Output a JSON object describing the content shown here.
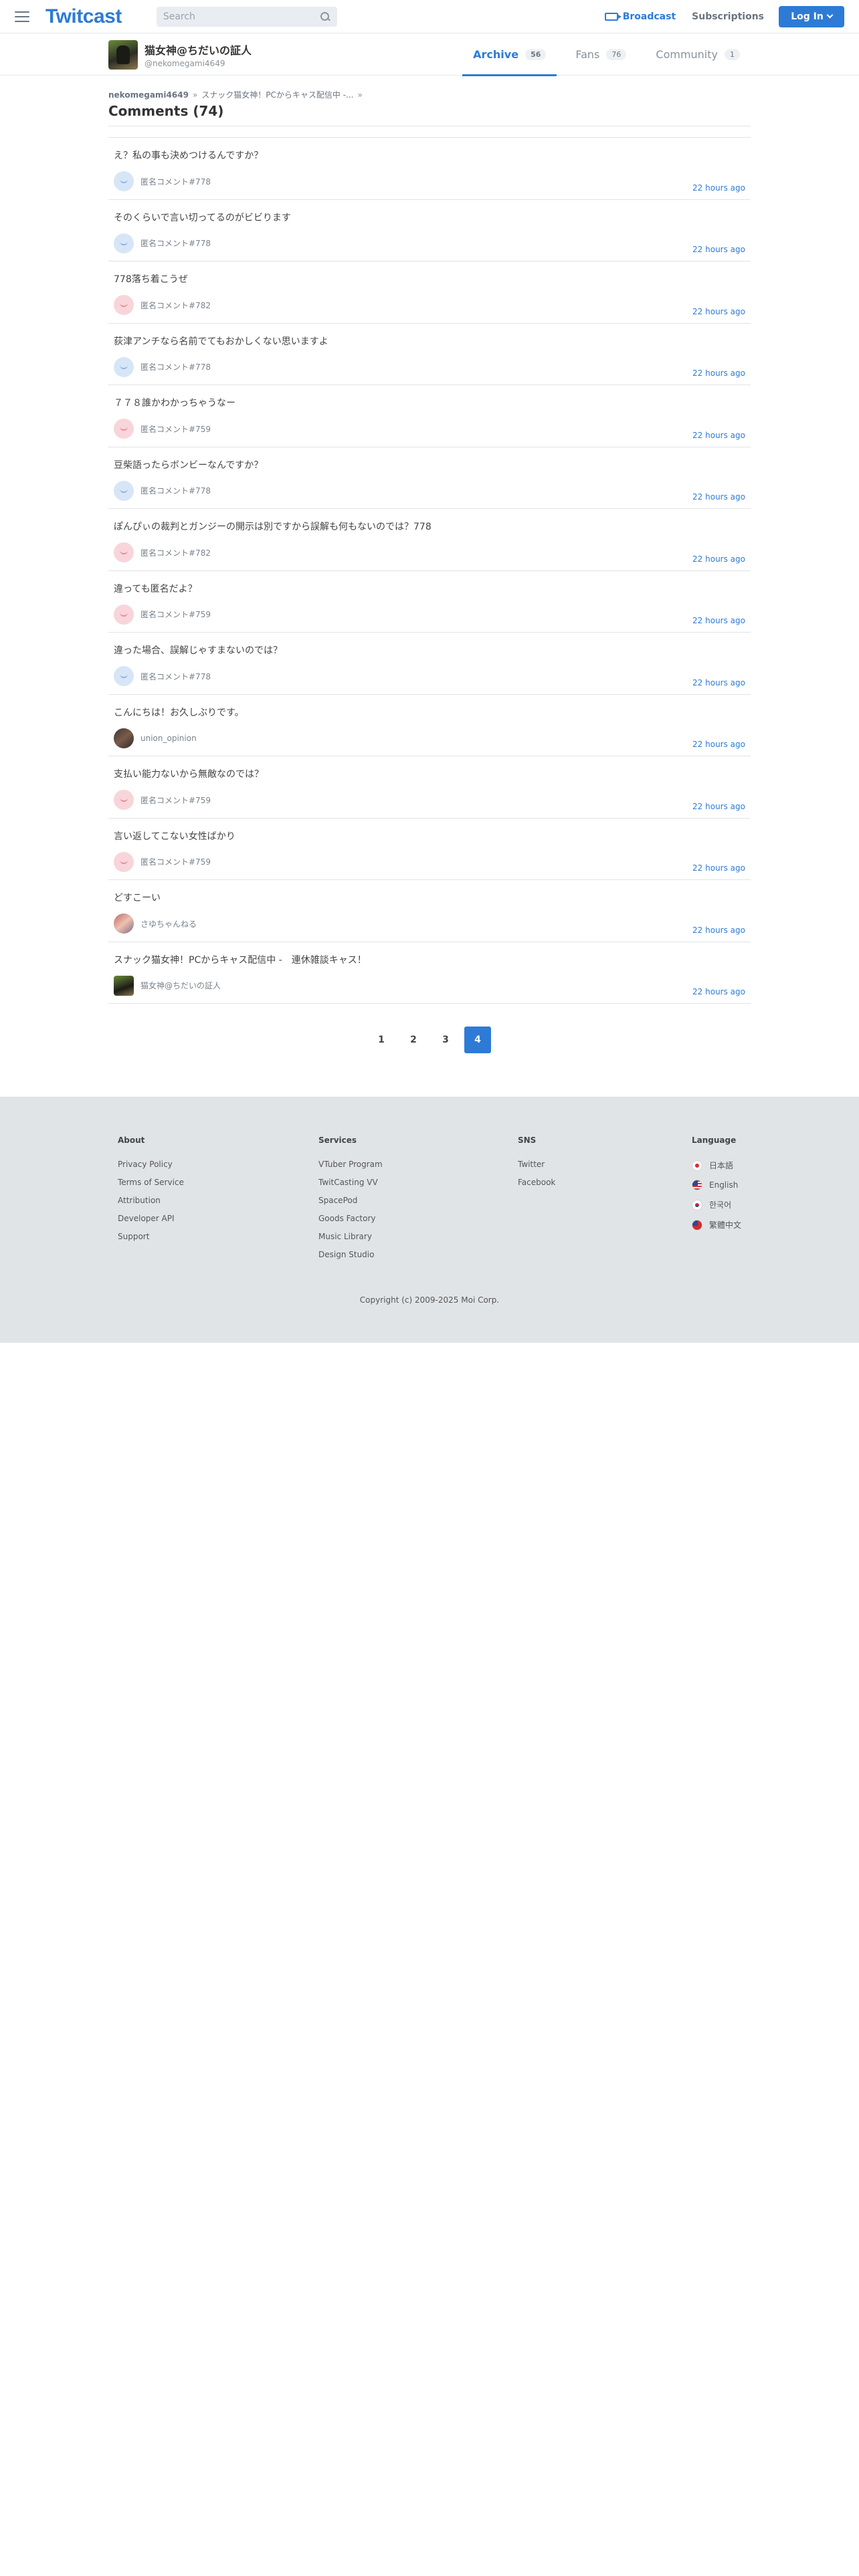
{
  "header": {
    "logo": "Twitcast",
    "search_placeholder": "Search",
    "broadcast_label": "Broadcast",
    "subscriptions_label": "Subscriptions",
    "login_label": "Log In"
  },
  "profile": {
    "name": "猫女神@ちだいの証人",
    "handle": "@nekomegami4649",
    "tabs": [
      {
        "label": "Archive",
        "count": "56"
      },
      {
        "label": "Fans",
        "count": "76"
      },
      {
        "label": "Community",
        "count": "1"
      }
    ]
  },
  "breadcrumb": {
    "user": "nekomegami4649",
    "sep1": "»",
    "movie": "スナック猫女神！PCからキャス配信中 -...",
    "sep2": "»"
  },
  "page_title": "Comments (74)",
  "comments": [
    {
      "message": "え？私の事も決めつけるんですか？",
      "user": "匿名コメント#778",
      "avatar": "blue",
      "time": "22 hours ago"
    },
    {
      "message": "そのくらいで言い切ってるのがビビります",
      "user": "匿名コメント#778",
      "avatar": "blue",
      "time": "22 hours ago"
    },
    {
      "message": "778落ち着こうぜ",
      "user": "匿名コメント#782",
      "avatar": "pink",
      "time": "22 hours ago"
    },
    {
      "message": "荻津アンチなら名前でてもおかしくない思いますよ",
      "user": "匿名コメント#778",
      "avatar": "blue",
      "time": "22 hours ago"
    },
    {
      "message": "７７８誰かわかっちゃうなー",
      "user": "匿名コメント#759",
      "avatar": "pink",
      "time": "22 hours ago"
    },
    {
      "message": "豆柴語ったらボンビーなんですか？",
      "user": "匿名コメント#778",
      "avatar": "blue",
      "time": "22 hours ago"
    },
    {
      "message": "ぽんぴぃの裁判とガンジーの開示は別ですから誤解も何もないのでは？778",
      "user": "匿名コメント#782",
      "avatar": "pink",
      "time": "22 hours ago"
    },
    {
      "message": "違っても匿名だよ？",
      "user": "匿名コメント#759",
      "avatar": "pink",
      "time": "22 hours ago"
    },
    {
      "message": "違った場合、誤解じゃすまないのでは？",
      "user": "匿名コメント#778",
      "avatar": "blue",
      "time": "22 hours ago"
    },
    {
      "message": "こんにちは！お久しぶりです。",
      "user": "union_opinion",
      "avatar": "photo",
      "time": "22 hours ago"
    },
    {
      "message": "支払い能力ないから無敵なのでは？",
      "user": "匿名コメント#759",
      "avatar": "pink",
      "time": "22 hours ago"
    },
    {
      "message": "言い返してこない女性ばかり",
      "user": "匿名コメント#759",
      "avatar": "pink",
      "time": "22 hours ago"
    },
    {
      "message": "どすこーい",
      "user": "さゆちゃんねる",
      "avatar": "photo2",
      "time": "22 hours ago"
    },
    {
      "message": "スナック猫女神！PCからキャス配信中 -　連休雑談キャス！",
      "user": "猫女神@ちだいの証人",
      "avatar": "photo3",
      "time": "22 hours ago"
    }
  ],
  "pagination": {
    "pages": [
      "1",
      "2",
      "3",
      "4"
    ],
    "current": "4"
  },
  "footer": {
    "about": {
      "title": "About",
      "links": [
        "Privacy Policy",
        "Terms of Service",
        "Attribution",
        "Developer API",
        "Support"
      ]
    },
    "services": {
      "title": "Services",
      "links": [
        "VTuber Program",
        "TwitCasting VV",
        "SpacePod",
        "Goods Factory",
        "Music Library",
        "Design Studio"
      ]
    },
    "sns": {
      "title": "SNS",
      "links": [
        "Twitter",
        "Facebook"
      ]
    },
    "language": {
      "title": "Language",
      "items": [
        {
          "label": "日本語",
          "flag": "jp"
        },
        {
          "label": "English",
          "flag": "us"
        },
        {
          "label": "한국어",
          "flag": "kr"
        },
        {
          "label": "繁體中文",
          "flag": "tw"
        }
      ]
    },
    "copyright": "Copyright (c) 2009-2025 Moi Corp."
  },
  "colors": {
    "accent": "#2d7bd6",
    "footer_bg": "#e1e4e6"
  }
}
